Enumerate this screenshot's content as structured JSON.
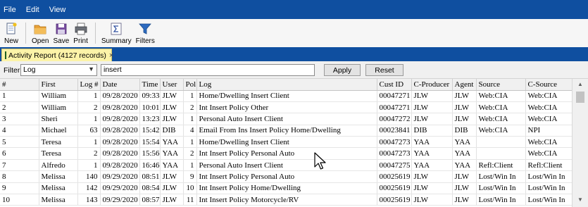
{
  "menu": [
    "File",
    "Edit",
    "View"
  ],
  "toolbar": {
    "new": "New",
    "open": "Open",
    "save": "Save",
    "print": "Print",
    "summary": "Summary",
    "filters": "Filters"
  },
  "tab": {
    "title": "Activity Report (4127 records)",
    "close": "×"
  },
  "filter": {
    "label": "Filter",
    "field": "Log",
    "value": "insert",
    "apply": "Apply",
    "reset": "Reset"
  },
  "table": {
    "columns": [
      "#",
      "First",
      "Log #",
      "Date",
      "Time",
      "User",
      "Pol",
      "Log",
      "Cust ID",
      "C-Producer",
      "Agent",
      "Source",
      "C-Source"
    ],
    "rows": [
      [
        "1",
        "William",
        "1",
        "09/28/2020",
        "09:33",
        "JLW",
        "1",
        "Home/Dwelling Insert Client",
        "00047271",
        "JLW",
        "JLW",
        "Web:CIA",
        "Web:CIA"
      ],
      [
        "2",
        "William",
        "2",
        "09/28/2020",
        "10:01",
        "JLW",
        "2",
        "Int Insert Policy Other",
        "00047271",
        "JLW",
        "JLW",
        "Web:CIA",
        "Web:CIA"
      ],
      [
        "3",
        "Sheri",
        "1",
        "09/28/2020",
        "13:23",
        "JLW",
        "1",
        "Personal Auto Insert Client",
        "00047272",
        "JLW",
        "JLW",
        "Web:CIA",
        "Web:CIA"
      ],
      [
        "4",
        "Michael",
        "63",
        "09/28/2020",
        "15:42",
        "DIB",
        "4",
        "Email From Ins Insert Policy Home/Dwelling",
        "00023841",
        "DIB",
        "DIB",
        "Web:CIA",
        "NPI"
      ],
      [
        "5",
        "Teresa",
        "1",
        "09/28/2020",
        "15:54",
        "YAA",
        "1",
        "Home/Dwelling Insert Client",
        "00047273",
        "YAA",
        "YAA",
        "",
        "Web:CIA"
      ],
      [
        "6",
        "Teresa",
        "2",
        "09/28/2020",
        "15:56",
        "YAA",
        "2",
        "Int Insert Policy Personal Auto",
        "00047273",
        "YAA",
        "YAA",
        "",
        "Web:CIA"
      ],
      [
        "7",
        "Alfredo",
        "1",
        "09/28/2020",
        "16:46",
        "YAA",
        "1",
        "Personal Auto Insert Client",
        "00047275",
        "YAA",
        "YAA",
        "Refl:Client",
        "Refl:Client"
      ],
      [
        "8",
        "Melissa",
        "140",
        "09/29/2020",
        "08:51",
        "JLW",
        "9",
        "Int Insert Policy Personal Auto",
        "00025619",
        "JLW",
        "JLW",
        "Lost/Win In",
        "Lost/Win In"
      ],
      [
        "9",
        "Melissa",
        "142",
        "09/29/2020",
        "08:54",
        "JLW",
        "10",
        "Int Insert Policy Home/Dwelling",
        "00025619",
        "JLW",
        "JLW",
        "Lost/Win In",
        "Lost/Win In"
      ],
      [
        "10",
        "Melissa",
        "143",
        "09/29/2020",
        "08:57",
        "JLW",
        "11",
        "Int Insert Policy Motorcycle/RV",
        "00025619",
        "JLW",
        "JLW",
        "Lost/Win In",
        "Lost/Win In"
      ]
    ]
  },
  "icons": {
    "new": "new-document-icon",
    "open": "folder-open-icon",
    "save": "floppy-disk-icon",
    "print": "printer-icon",
    "summary": "sigma-icon",
    "filters": "funnel-icon",
    "tab": "report-icon",
    "cursor": "mouse-pointer-icon"
  },
  "colors": {
    "menubar": "#0f4fa0",
    "tab_active": "#fcf3a8",
    "folder": "#e8a23a",
    "save": "#7a4fa0",
    "filter_funnel": "#2d6bc0",
    "report_icon": "#2e8b2e"
  }
}
